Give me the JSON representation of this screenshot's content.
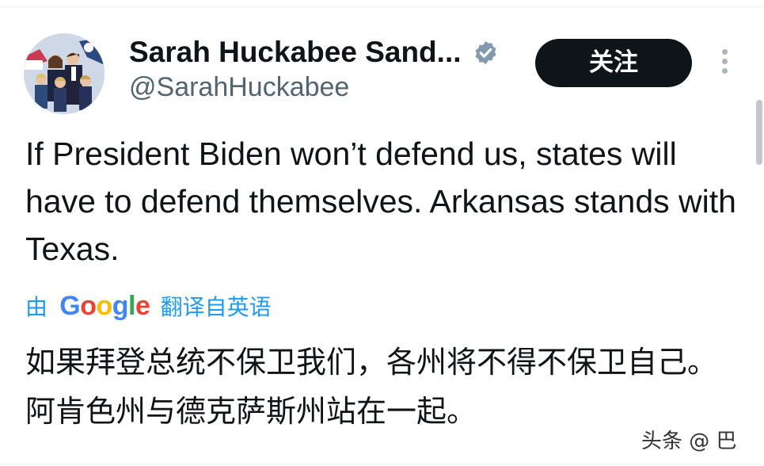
{
  "tweet": {
    "author": {
      "display_name": "Sarah Huckabee Sand...",
      "handle": "@SarahHuckabee",
      "verified": true,
      "avatar_icon": "profile-photo-icon"
    },
    "follow_label": "关注",
    "text": "If President Biden won’t defend us, states will have to defend themselves. Arkansas stands with Texas.",
    "translation": {
      "prefix": "由",
      "provider": "Google",
      "suffix": "翻译自英语",
      "text": "如果拜登总统不保卫我们，各州将不得不保卫自己。阿肯色州与德克萨斯州站在一起。"
    }
  },
  "watermark": "头条 @ 巴",
  "colors": {
    "link": "#1d9bf0",
    "text": "#0f1419",
    "secondary": "#536471",
    "button_bg": "#0f1419",
    "google_blue": "#4285f4",
    "google_red": "#ea4335",
    "google_yellow": "#fbbc05",
    "google_green": "#34a853"
  },
  "icons": {
    "verified": "verified-badge-icon",
    "more": "more-dots-vertical-icon"
  }
}
